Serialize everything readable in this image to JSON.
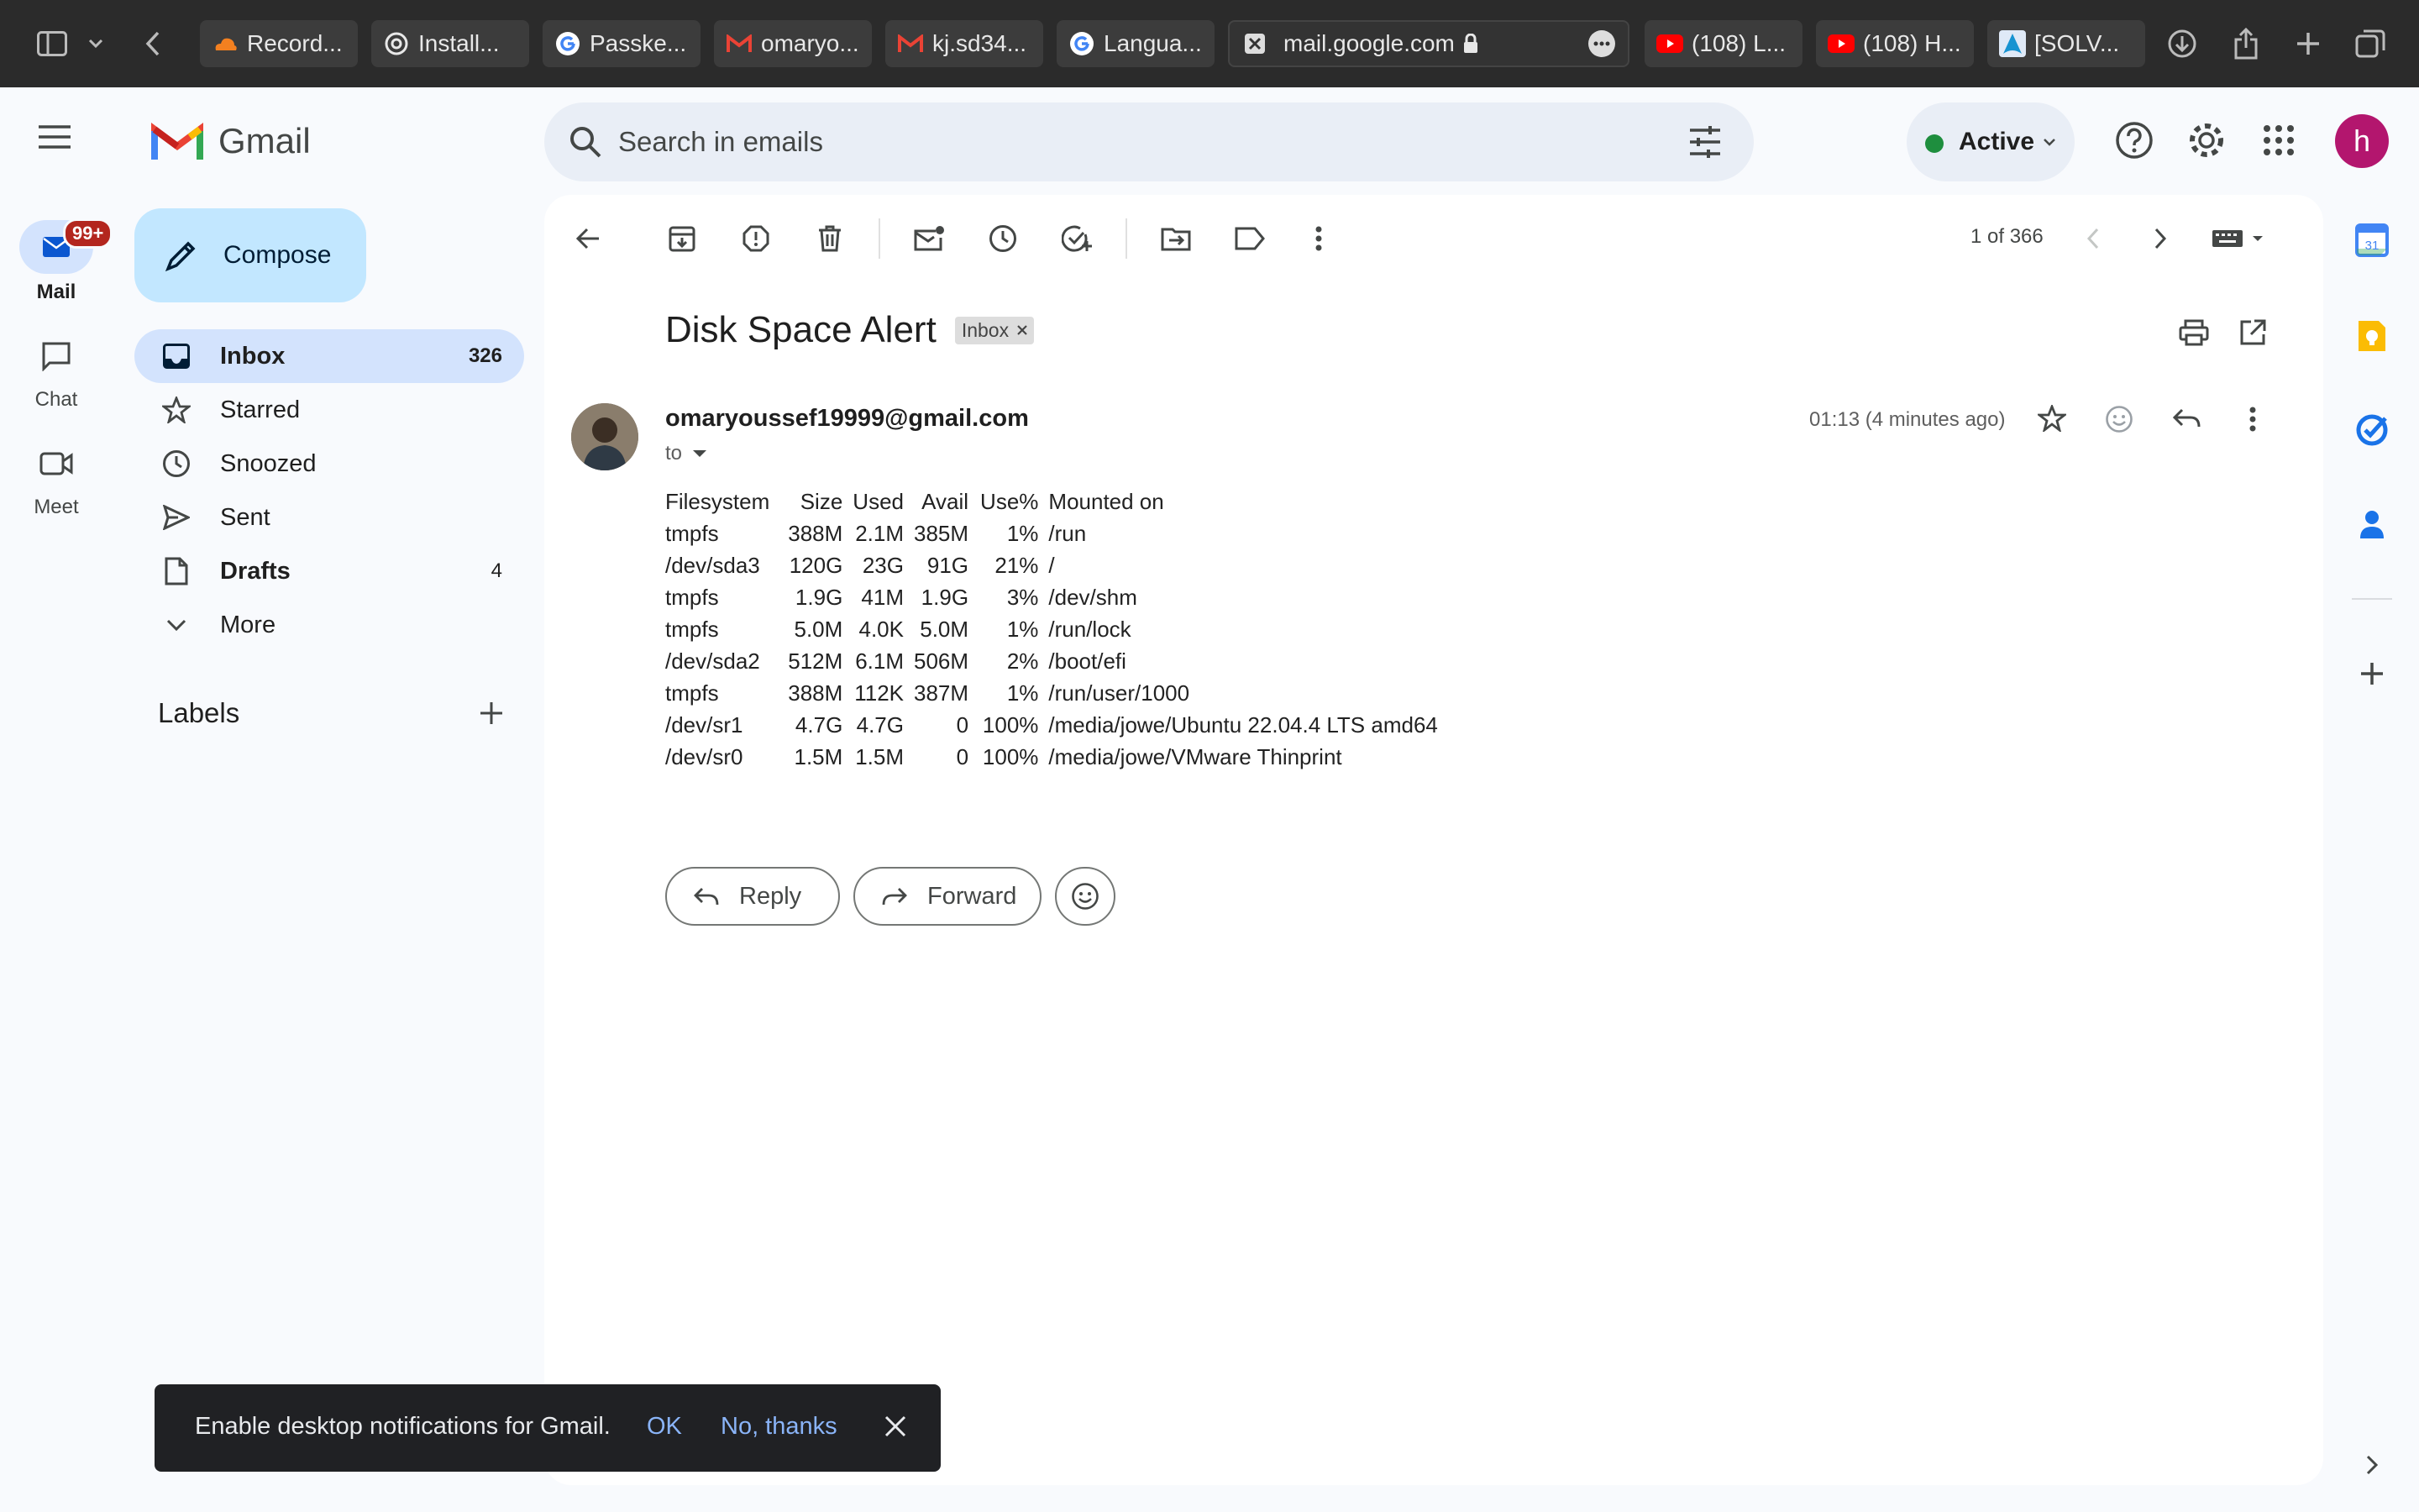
{
  "browser": {
    "tabs": [
      {
        "label": "Record...",
        "icon": "cloudflare-icon"
      },
      {
        "label": "Install...",
        "icon": "chatgpt-icon"
      },
      {
        "label": "Passke...",
        "icon": "google-icon"
      },
      {
        "label": "omaryo...",
        "icon": "gmail-icon"
      },
      {
        "label": "kj.sd34...",
        "icon": "gmail-icon"
      },
      {
        "label": "Langua...",
        "icon": "google-icon"
      },
      {
        "label": "mail.google.com",
        "icon": "close-icon"
      },
      {
        "label": "(108) L...",
        "icon": "youtube-icon"
      },
      {
        "label": "(108) H...",
        "icon": "youtube-icon"
      },
      {
        "label": "[SOLV...",
        "icon": "arch-icon"
      }
    ]
  },
  "app": {
    "name": "Gmail",
    "search_placeholder": "Search in emails",
    "status": "Active",
    "status_color": "#1e8e3e",
    "avatar_letter": "h",
    "avatar_color": "#b3166e"
  },
  "rail": {
    "mail_label": "Mail",
    "mail_badge": "99+",
    "chat_label": "Chat",
    "meet_label": "Meet"
  },
  "nav": {
    "compose": "Compose",
    "items": [
      {
        "label": "Inbox",
        "count": "326"
      },
      {
        "label": "Starred",
        "count": ""
      },
      {
        "label": "Snoozed",
        "count": ""
      },
      {
        "label": "Sent",
        "count": ""
      },
      {
        "label": "Drafts",
        "count": "4"
      },
      {
        "label": "More",
        "count": ""
      }
    ],
    "labels_heading": "Labels"
  },
  "toolbar": {
    "pagination": "1 of 366"
  },
  "email": {
    "subject": "Disk Space Alert",
    "label_chip": "Inbox",
    "sender": "omaryoussef19999@gmail.com",
    "to": "to",
    "time": "01:13 (4 minutes ago)",
    "body_rows": [
      [
        "Filesystem",
        "Size",
        "Used",
        "Avail",
        "Use%",
        "Mounted on"
      ],
      [
        "tmpfs",
        "388M",
        "2.1M",
        "385M",
        "1%",
        "/run"
      ],
      [
        "/dev/sda3",
        "120G",
        "23G",
        "91G",
        "21%",
        "/"
      ],
      [
        "tmpfs",
        "1.9G",
        "41M",
        "1.9G",
        "3%",
        "/dev/shm"
      ],
      [
        "tmpfs",
        "5.0M",
        "4.0K",
        "5.0M",
        "1%",
        "/run/lock"
      ],
      [
        "/dev/sda2",
        "512M",
        "6.1M",
        "506M",
        "2%",
        "/boot/efi"
      ],
      [
        "tmpfs",
        "388M",
        "112K",
        "387M",
        "1%",
        "/run/user/1000"
      ],
      [
        "/dev/sr1",
        "4.7G",
        "4.7G",
        "0",
        "100%",
        "/media/jowe/Ubuntu 22.04.4 LTS amd64"
      ],
      [
        "/dev/sr0",
        "1.5M",
        "1.5M",
        "0",
        "100%",
        "/media/jowe/VMware Thinprint"
      ]
    ],
    "reply": "Reply",
    "forward": "Forward"
  },
  "toast": {
    "message": "Enable desktop notifications for Gmail.",
    "ok": "OK",
    "no": "No, thanks"
  }
}
